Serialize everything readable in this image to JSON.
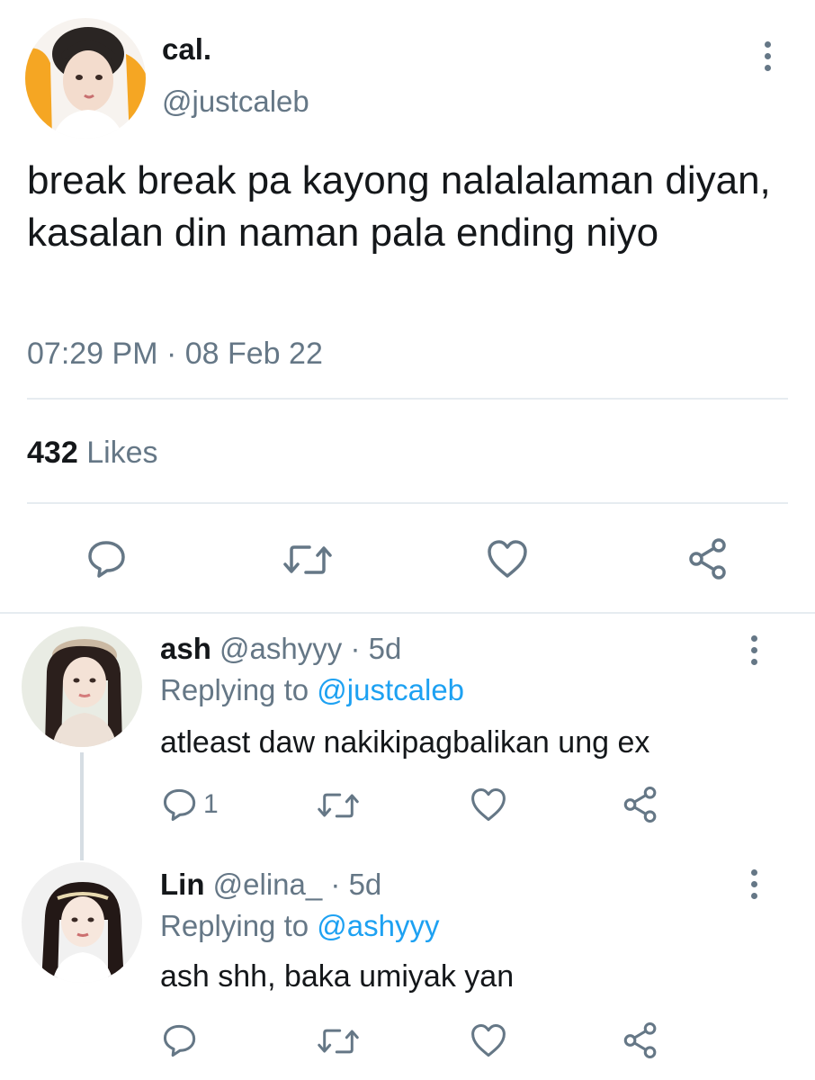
{
  "tweet": {
    "display_name": "cal.",
    "handle": "@justcaleb",
    "text": "break break pa kayong nalalalaman diyan, kasalan din naman pala ending niyo",
    "timestamp": "07:29 PM · 08 Feb 22",
    "likes_count": "432",
    "likes_label": "Likes"
  },
  "replies": [
    {
      "display_name": "ash",
      "handle": "@ashyyy",
      "age": "· 5d",
      "replying_prefix": "Replying to",
      "replying_to": "@justcaleb",
      "text": "atleast daw nakikipagbalikan ung ex",
      "reply_count": "1"
    },
    {
      "display_name": "Lin",
      "handle": "@elina_",
      "age": "· 5d",
      "replying_prefix": "Replying to",
      "replying_to": "@ashyyy",
      "text": "ash shh, baka umiyak yan",
      "reply_count": ""
    }
  ],
  "icons": {
    "reply": "reply-icon",
    "retweet": "retweet-icon",
    "like": "heart-icon",
    "share": "share-icon",
    "more": "more-icon"
  },
  "colors": {
    "link": "#1da1f2",
    "muted": "#657786",
    "icon": "#657786",
    "divider": "#e6ecf0"
  }
}
